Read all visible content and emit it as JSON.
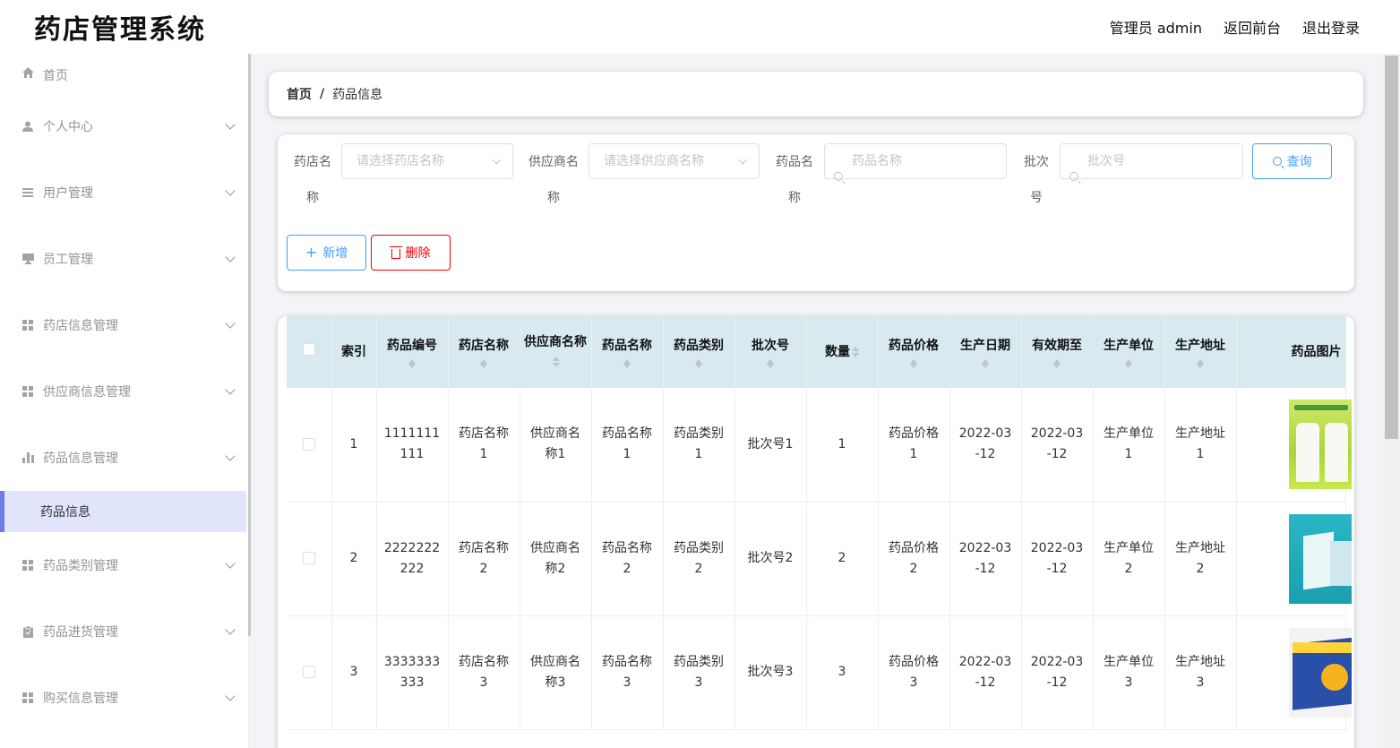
{
  "app": {
    "title": "药店管理系统",
    "header_links": [
      "管理员 admin",
      "返回前台",
      "退出登录"
    ]
  },
  "sidebar": {
    "items": [
      {
        "label": "首页",
        "icon": "home-icon"
      },
      {
        "label": "个人中心",
        "icon": "user-icon"
      },
      {
        "label": "用户管理",
        "icon": "list-icon"
      },
      {
        "label": "员工管理",
        "icon": "monitor-icon"
      },
      {
        "label": "药店信息管理",
        "icon": "grid-icon"
      },
      {
        "label": "供应商信息管理",
        "icon": "grid-icon"
      },
      {
        "label": "药品信息管理",
        "icon": "bar-chart-icon"
      },
      {
        "label": "药品类别管理",
        "icon": "grid-icon"
      },
      {
        "label": "药品进货管理",
        "icon": "clipboard-icon"
      },
      {
        "label": "购买信息管理",
        "icon": "grid-icon"
      }
    ],
    "active_sub": "药品信息"
  },
  "breadcrumb": {
    "home": "首页",
    "separator": "/",
    "current": "药品信息"
  },
  "search": {
    "pharmacy_label": [
      "药店名",
      "称"
    ],
    "pharmacy_placeholder": "请选择药店名称",
    "supplier_label": [
      "供应商名",
      "称"
    ],
    "supplier_placeholder": "请选择供应商名称",
    "drug_label": [
      "药品名",
      "称"
    ],
    "drug_placeholder": "药品名称",
    "batch_label": [
      "批次",
      "号"
    ],
    "batch_placeholder": "批次号",
    "query_button": "查询",
    "add_button": "新增",
    "delete_button": "删除"
  },
  "table": {
    "headers": [
      "索引",
      "药品编号",
      "药店名称",
      "供应商名称",
      "药品名称",
      "药品类别",
      "批次号",
      "数量",
      "药品价格",
      "生产日期",
      "有效期至",
      "生产单位",
      "生产地址",
      "药品图片"
    ],
    "rows": [
      {
        "index": "1",
        "code": "1111111111",
        "pharmacy": "药店名称1",
        "supplier": "供应商名称1",
        "name": "药品名称1",
        "category": "药品类别1",
        "batch": "批次号1",
        "qty": "1",
        "price": "药品价格1",
        "mfg_date": "2022-03-12",
        "expiry": "2022-03-12",
        "maker": "生产单位1",
        "address": "生产地址1"
      },
      {
        "index": "2",
        "code": "2222222222",
        "pharmacy": "药店名称2",
        "supplier": "供应商名称2",
        "name": "药品名称2",
        "category": "药品类别2",
        "batch": "批次号2",
        "qty": "2",
        "price": "药品价格2",
        "mfg_date": "2022-03-12",
        "expiry": "2022-03-12",
        "maker": "生产单位2",
        "address": "生产地址2"
      },
      {
        "index": "3",
        "code": "3333333333",
        "pharmacy": "药店名称3",
        "supplier": "供应商名称3",
        "name": "药品名称3",
        "category": "药品类别3",
        "batch": "批次号3",
        "qty": "3",
        "price": "药品价格3",
        "mfg_date": "2022-03-12",
        "expiry": "2022-03-12",
        "maker": "生产单位3",
        "address": "生产地址3"
      }
    ]
  },
  "colors": {
    "primary": "#409eff",
    "danger": "#ee0000",
    "header_bg": "#d8eaf0",
    "active_menu_bg": "#e1e5fb",
    "active_menu_bar": "#6c7de8"
  }
}
